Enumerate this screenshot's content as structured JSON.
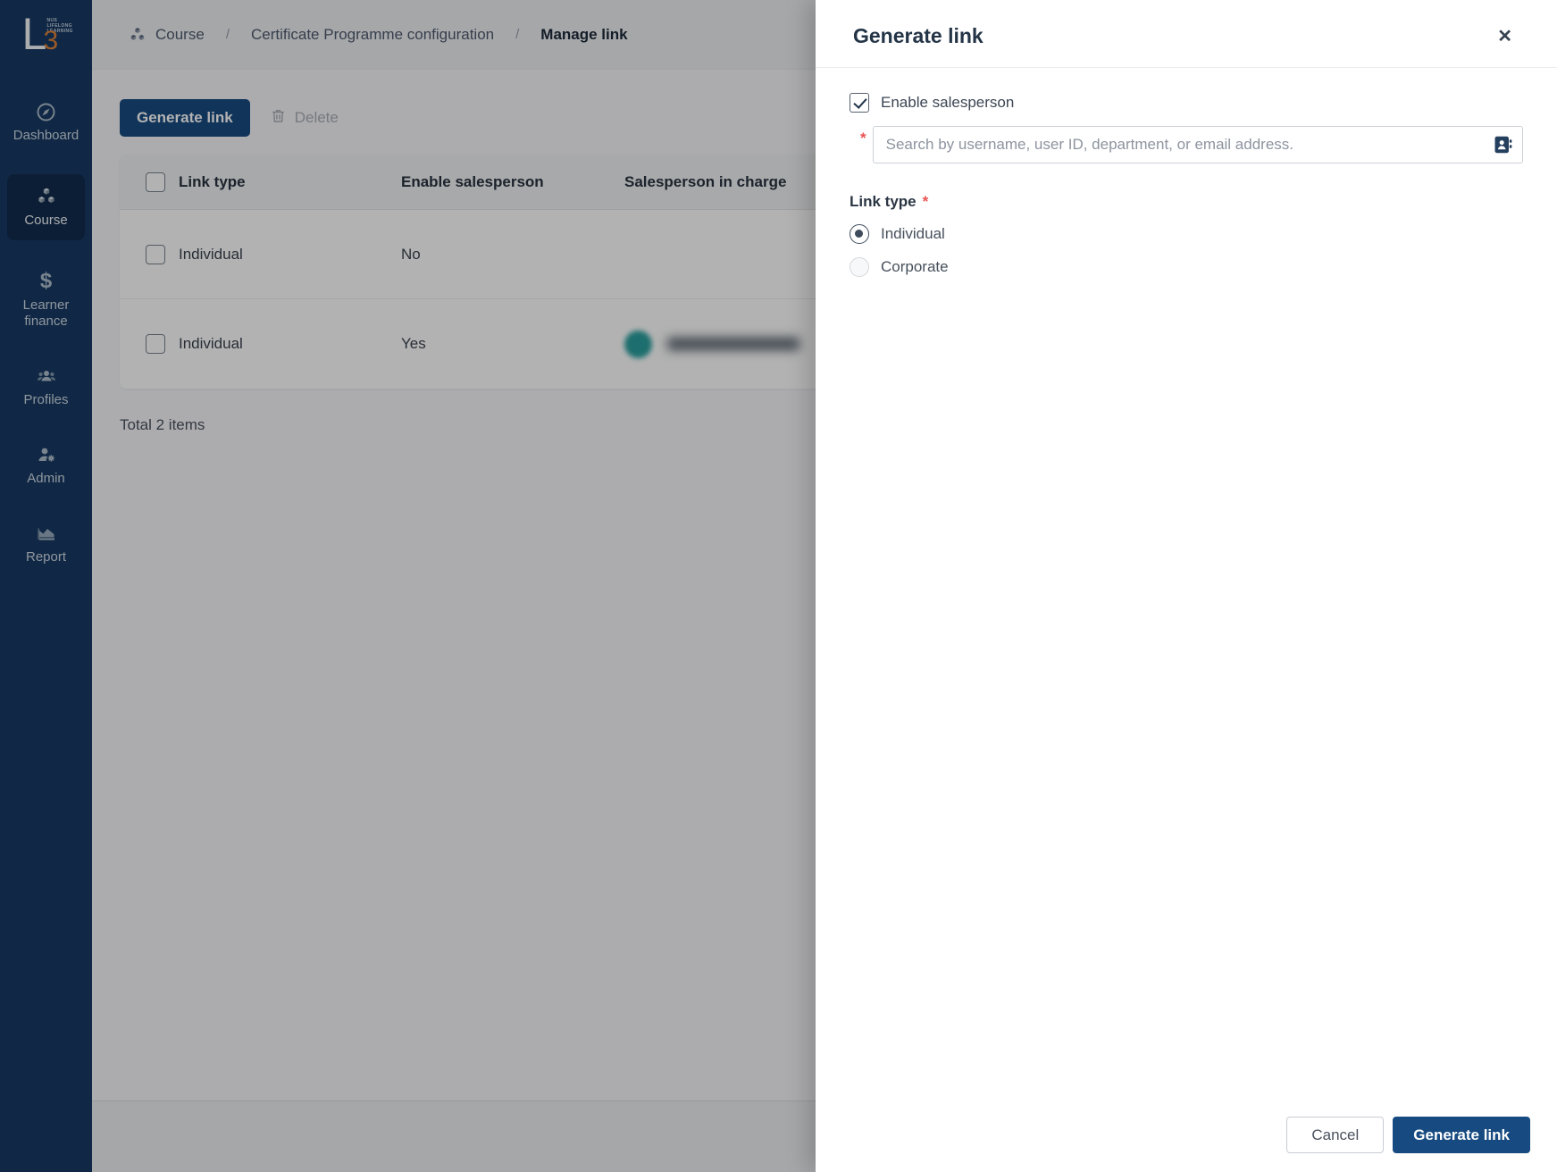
{
  "logo": {
    "letter": "L",
    "number": "3",
    "tagline_lines": [
      "NUS",
      "LIFELONG",
      "LEARNING"
    ]
  },
  "sidebar": {
    "items": [
      {
        "label": "Dashboard",
        "icon": "compass-icon",
        "active": false
      },
      {
        "label": "Course",
        "icon": "cubes-icon",
        "active": true
      },
      {
        "label": "Learner finance",
        "icon": "dollar-icon",
        "active": false
      },
      {
        "label": "Profiles",
        "icon": "team-icon",
        "active": false
      },
      {
        "label": "Admin",
        "icon": "user-gear-icon",
        "active": false
      },
      {
        "label": "Report",
        "icon": "chart-icon",
        "active": false
      }
    ]
  },
  "breadcrumb": {
    "separator": "/",
    "items": [
      "Course",
      "Certificate Programme configuration",
      "Manage link"
    ]
  },
  "toolbar": {
    "generate_link_label": "Generate link",
    "delete_label": "Delete"
  },
  "table": {
    "columns": [
      "Link type",
      "Enable salesperson",
      "Salesperson in charge"
    ],
    "rows": [
      {
        "link_type": "Individual",
        "enable_salesperson": "No",
        "salesperson_redacted": false
      },
      {
        "link_type": "Individual",
        "enable_salesperson": "Yes",
        "salesperson_redacted": true,
        "avatar_color": "#2a9e9e"
      }
    ],
    "total_label": "Total 2 items"
  },
  "drawer": {
    "title": "Generate link",
    "close_icon": "✕",
    "enable_salesperson": {
      "label": "Enable salesperson",
      "checked": true
    },
    "salesperson_search": {
      "required_mark": "*",
      "placeholder": "Search by username, user ID, department, or email address.",
      "value": ""
    },
    "link_type": {
      "label": "Link type",
      "required_mark": "*",
      "options": [
        {
          "label": "Individual",
          "selected": true
        },
        {
          "label": "Corporate",
          "selected": false
        }
      ]
    },
    "footer": {
      "cancel_label": "Cancel",
      "submit_label": "Generate link"
    }
  },
  "colors": {
    "sidebar_navy": "#173a63",
    "sidebar_active": "#122c4e",
    "primary_navy": "#164a80",
    "avatar_teal": "#2a9e9e",
    "accent_orange": "#dd8238",
    "required_red": "#e85252"
  }
}
